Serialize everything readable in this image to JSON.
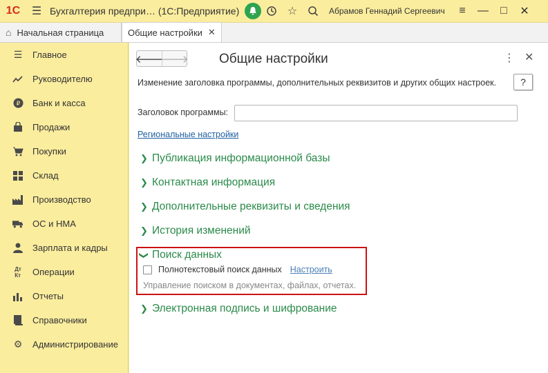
{
  "app": {
    "logo": "1С",
    "title": "Бухгалтерия предпри…  (1С:Предприятие)",
    "user": "Абрамов Геннадий Сергеевич"
  },
  "tabs": [
    {
      "label": "Начальная страница"
    },
    {
      "label": "Общие настройки"
    }
  ],
  "sidebar": {
    "items": [
      {
        "label": "Главное",
        "icon": "menu-lines-icon"
      },
      {
        "label": "Руководителю",
        "icon": "trend-icon"
      },
      {
        "label": "Банк и касса",
        "icon": "ruble-coin-icon"
      },
      {
        "label": "Продажи",
        "icon": "shopping-bag-icon"
      },
      {
        "label": "Покупки",
        "icon": "cart-icon"
      },
      {
        "label": "Склад",
        "icon": "warehouse-grid-icon"
      },
      {
        "label": "Производство",
        "icon": "factory-icon"
      },
      {
        "label": "ОС и НМА",
        "icon": "truck-icon"
      },
      {
        "label": "Зарплата и кадры",
        "icon": "person-icon"
      },
      {
        "label": "Операции",
        "icon": "debit-credit-icon"
      },
      {
        "label": "Отчеты",
        "icon": "bar-chart-icon"
      },
      {
        "label": "Справочники",
        "icon": "book-icon"
      },
      {
        "label": "Администрирование",
        "icon": "gear-icon"
      }
    ]
  },
  "page": {
    "title": "Общие настройки",
    "help_label": "?",
    "description": "Изменение заголовка программы, дополнительных реквизитов и других общих настроек.",
    "header_field_label": "Заголовок программы:",
    "header_field_value": "",
    "regional_link": "Региональные настройки",
    "sections": [
      {
        "label": "Публикация информационной базы",
        "expanded": false
      },
      {
        "label": "Контактная информация",
        "expanded": false
      },
      {
        "label": "Дополнительные реквизиты и сведения",
        "expanded": false
      },
      {
        "label": "История изменений",
        "expanded": false
      },
      {
        "label": "Поиск данных",
        "expanded": true
      },
      {
        "label": "Электронная подпись и шифрование",
        "expanded": false
      }
    ],
    "search": {
      "checkbox_label": "Полнотекстовый поиск данных",
      "checked": false,
      "configure_link": "Настроить",
      "hint": "Управление поиском в документах, файлах, отчетах."
    }
  },
  "colors": {
    "panel_bg": "#fbed9e",
    "section_text": "#2a8a4a",
    "link": "#1f5fa0",
    "highlight": "#cc1111",
    "logo": "#d52b1e"
  }
}
